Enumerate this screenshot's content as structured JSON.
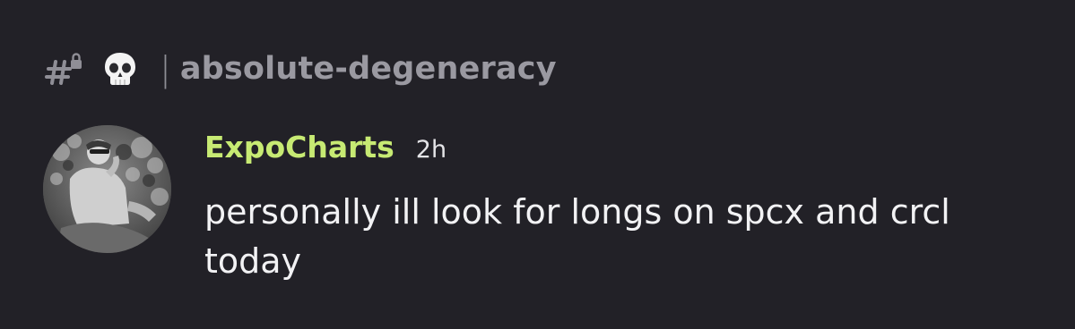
{
  "channel": {
    "icon": "hash-lock-icon",
    "emoji_icon": "skull-icon",
    "separator": "|",
    "name": "absolute-degeneracy"
  },
  "message": {
    "avatar": "avatar",
    "author": "ExpoCharts",
    "author_color": "#c7ea73",
    "timestamp": "2h",
    "text": "personally ill look for longs on spcx and crcl today"
  }
}
